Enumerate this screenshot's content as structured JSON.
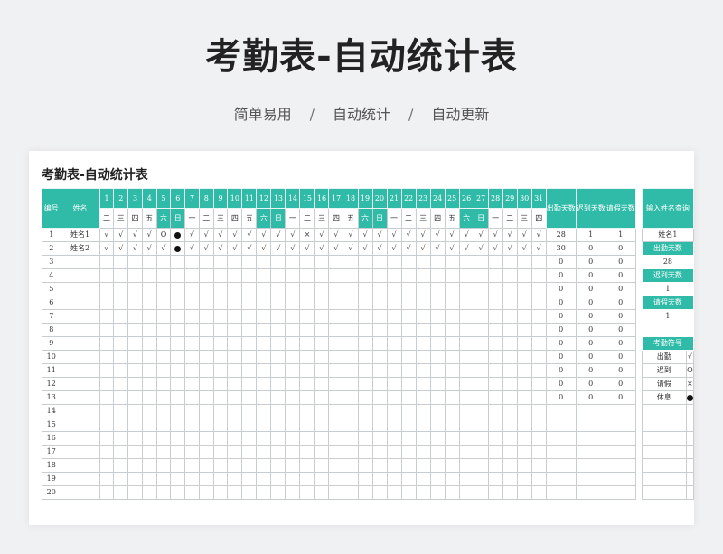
{
  "hero": {
    "title": "考勤表-自动统计表",
    "subtitle_items": [
      "简单易用",
      "自动统计",
      "自动更新"
    ],
    "separator": "/"
  },
  "sheet": {
    "title": "考勤表-自动统计表",
    "header": {
      "id_label": "编号",
      "name_label": "姓名",
      "present_days": "出勤天数",
      "late_days": "迟到天数",
      "leave_days": "请假天数"
    },
    "days": [
      "1",
      "2",
      "3",
      "4",
      "5",
      "6",
      "7",
      "8",
      "9",
      "10",
      "11",
      "12",
      "13",
      "14",
      "15",
      "16",
      "17",
      "18",
      "19",
      "20",
      "21",
      "22",
      "23",
      "24",
      "25",
      "26",
      "27",
      "28",
      "29",
      "30",
      "31"
    ],
    "weekdays": [
      "二",
      "三",
      "四",
      "五",
      "六",
      "日",
      "一",
      "二",
      "三",
      "四",
      "五",
      "六",
      "日",
      "一",
      "二",
      "三",
      "四",
      "五",
      "六",
      "日",
      "一",
      "二",
      "三",
      "四",
      "五",
      "六",
      "日",
      "一",
      "二",
      "三",
      "四"
    ],
    "rows": [
      {
        "no": "1",
        "name": "姓名1",
        "marks": [
          "√",
          "√",
          "√",
          "√",
          "O",
          "●",
          "√",
          "√",
          "√",
          "√",
          "√",
          "√",
          "√",
          "√",
          "×",
          "√",
          "√",
          "√",
          "√",
          "√",
          "√",
          "√",
          "√",
          "√",
          "√",
          "√",
          "√",
          "√",
          "√",
          "√",
          "√"
        ],
        "present": "28",
        "late": "1",
        "leave": "1"
      },
      {
        "no": "2",
        "name": "姓名2",
        "marks": [
          "√",
          "√",
          "√",
          "√",
          "√",
          "●",
          "√",
          "√",
          "√",
          "√",
          "√",
          "√",
          "√",
          "√",
          "√",
          "√",
          "√",
          "√",
          "√",
          "√",
          "√",
          "√",
          "√",
          "√",
          "√",
          "√",
          "√",
          "√",
          "√",
          "√",
          "√"
        ],
        "present": "30",
        "late": "0",
        "leave": "0"
      },
      {
        "no": "3",
        "name": "",
        "marks": [],
        "present": "0",
        "late": "0",
        "leave": "0"
      },
      {
        "no": "4",
        "name": "",
        "marks": [],
        "present": "0",
        "late": "0",
        "leave": "0"
      },
      {
        "no": "5",
        "name": "",
        "marks": [],
        "present": "0",
        "late": "0",
        "leave": "0"
      },
      {
        "no": "6",
        "name": "",
        "marks": [],
        "present": "0",
        "late": "0",
        "leave": "0"
      },
      {
        "no": "7",
        "name": "",
        "marks": [],
        "present": "0",
        "late": "0",
        "leave": "0"
      },
      {
        "no": "8",
        "name": "",
        "marks": [],
        "present": "0",
        "late": "0",
        "leave": "0"
      },
      {
        "no": "9",
        "name": "",
        "marks": [],
        "present": "0",
        "late": "0",
        "leave": "0"
      },
      {
        "no": "10",
        "name": "",
        "marks": [],
        "present": "0",
        "late": "0",
        "leave": "0"
      },
      {
        "no": "11",
        "name": "",
        "marks": [],
        "present": "0",
        "late": "0",
        "leave": "0"
      },
      {
        "no": "12",
        "name": "",
        "marks": [],
        "present": "0",
        "late": "0",
        "leave": "0"
      },
      {
        "no": "13",
        "name": "",
        "marks": [],
        "present": "0",
        "late": "0",
        "leave": "0"
      },
      {
        "no": "14",
        "name": "",
        "marks": [],
        "present": "",
        "late": "",
        "leave": ""
      },
      {
        "no": "15",
        "name": "",
        "marks": [],
        "present": "",
        "late": "",
        "leave": ""
      },
      {
        "no": "16",
        "name": "",
        "marks": [],
        "present": "",
        "late": "",
        "leave": ""
      },
      {
        "no": "17",
        "name": "",
        "marks": [],
        "present": "",
        "late": "",
        "leave": ""
      },
      {
        "no": "18",
        "name": "",
        "marks": [],
        "present": "",
        "late": "",
        "leave": ""
      },
      {
        "no": "19",
        "name": "",
        "marks": [],
        "present": "",
        "late": "",
        "leave": ""
      },
      {
        "no": "20",
        "name": "",
        "marks": [],
        "present": "",
        "late": "",
        "leave": ""
      }
    ],
    "lookup": {
      "title": "输入姓名查询",
      "name_value": "姓名1",
      "present_label": "出勤天数",
      "present_value": "28",
      "late_label": "迟到天数",
      "late_value": "1",
      "leave_label": "请假天数",
      "leave_value": "1"
    },
    "legend": {
      "title": "考勤符号",
      "items": [
        {
          "label": "出勤",
          "symbol": "√"
        },
        {
          "label": "迟到",
          "symbol": "O"
        },
        {
          "label": "请假",
          "symbol": "×"
        },
        {
          "label": "休息",
          "symbol": "●"
        }
      ]
    },
    "colors": {
      "accent": "#2fbba8"
    }
  }
}
